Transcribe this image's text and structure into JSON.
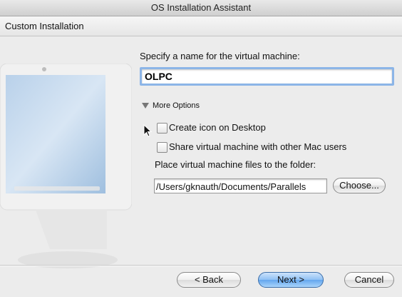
{
  "window": {
    "title": "OS Installation Assistant"
  },
  "header": {
    "title": "Custom Installation"
  },
  "form": {
    "name_label": "Specify a name for the virtual machine:",
    "name_value": "OLPC",
    "more_options_label": "More Options",
    "create_icon_label": "Create icon on Desktop",
    "create_icon_checked": false,
    "share_label": "Share virtual machine with other Mac users",
    "share_checked": false,
    "folder_label": "Place virtual machine files to the folder:",
    "folder_path": "/Users/gknauth/Documents/Parallels",
    "choose_label": "Choose..."
  },
  "footer": {
    "back_label": "< Back",
    "next_label": "Next >",
    "cancel_label": "Cancel"
  },
  "colors": {
    "focus_ring": "#8cb5e7",
    "default_button": "#64a6ee"
  }
}
